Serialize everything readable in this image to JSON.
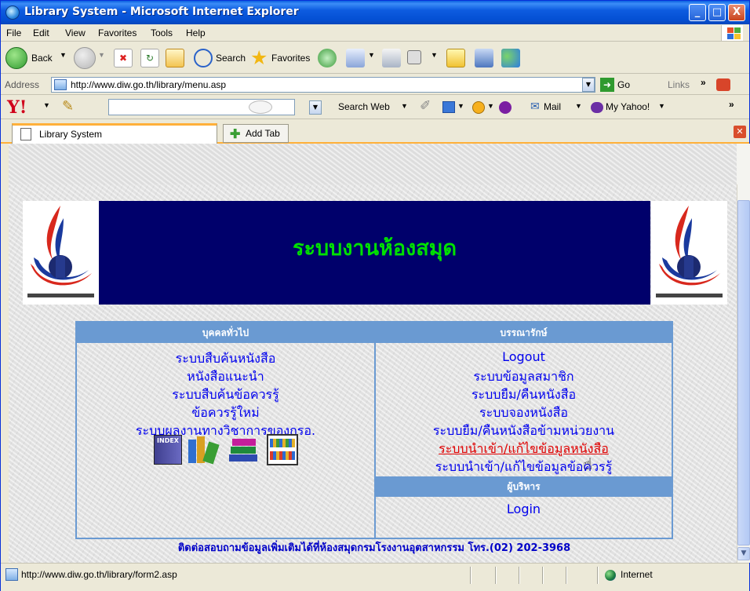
{
  "window": {
    "title": "Library System - Microsoft Internet Explorer",
    "min": "_",
    "max": "□",
    "close": "X"
  },
  "menubar": [
    "File",
    "Edit",
    "View",
    "Favorites",
    "Tools",
    "Help"
  ],
  "toolbar": {
    "back": "Back",
    "search": "Search",
    "favorites": "Favorites"
  },
  "address": {
    "label": "Address",
    "url": "http://www.diw.go.th/library/menu.asp",
    "go": "Go",
    "links": "Links"
  },
  "yahoo": {
    "logo": "Y!",
    "search_web": "Search Web",
    "mail": "Mail",
    "my_yahoo": "My Yahoo!"
  },
  "tabs": {
    "active": "Library System",
    "add": "Add Tab"
  },
  "page": {
    "banner_title": "ระบบงานห้องสมุด",
    "left_header": "บุคคลทั่วไป",
    "left_links": [
      "ระบบสืบค้นหนังสือ",
      "หนังสือแนะนำ",
      "ระบบสืบค้นข้อควรรู้",
      "ข้อควรรู้ใหม่",
      "ระบบผลงานทางวิชาการของกรอ."
    ],
    "right_header": "บรรณารักษ์",
    "right_links": [
      "Logout",
      "ระบบข้อมูลสมาชิก",
      "ระบบยืม/คืนหนังสือ",
      "ระบบจองหนังสือ",
      "ระบบยืม/คืนหนังสือข้ามหน่วยงาน",
      "ระบบนำเข้า/แก้ไขข้อมูลหนังสือ",
      "ระบบนำเข้า/แก้ไขข้อมูลข้อควรรู้"
    ],
    "admin_header": "ผู้บริหาร",
    "admin_link": "Login",
    "footer": "ติดต่อสอบถามข้อมูลเพิ่มเติมได้ที่ห้องสมุดกรมโรงงานอุตสาหกรรม โทร.(02) 202-3968",
    "index_icon_label": "INDEX"
  },
  "status": {
    "url": "http://www.diw.go.th/library/form2.asp",
    "zone": "Internet"
  },
  "colors": {
    "banner_bg": "#00006b",
    "banner_text": "#00e000",
    "header_bg": "#6a9ad2",
    "link": "#0000ee",
    "hover_link": "#e00000"
  }
}
